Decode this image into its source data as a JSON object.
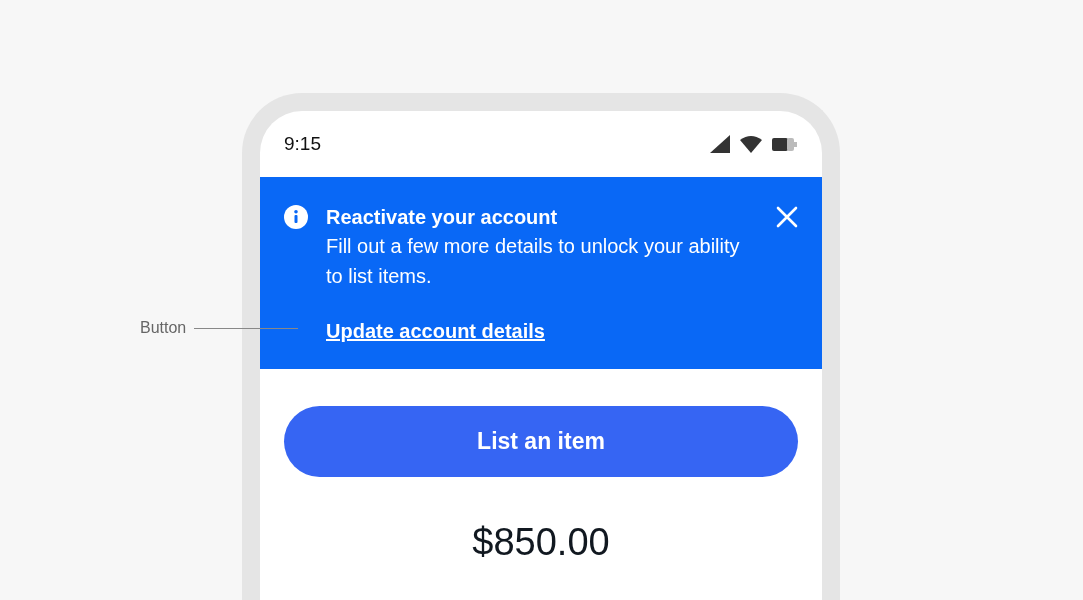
{
  "annotation": {
    "label": "Button"
  },
  "status_bar": {
    "time": "9:15"
  },
  "banner": {
    "title": "Reactivate your account",
    "message": "Fill out a few more details to unlock your ability to list items.",
    "link": "Update account details"
  },
  "primary_button": {
    "label": "List an item"
  },
  "price": "$850.00"
}
